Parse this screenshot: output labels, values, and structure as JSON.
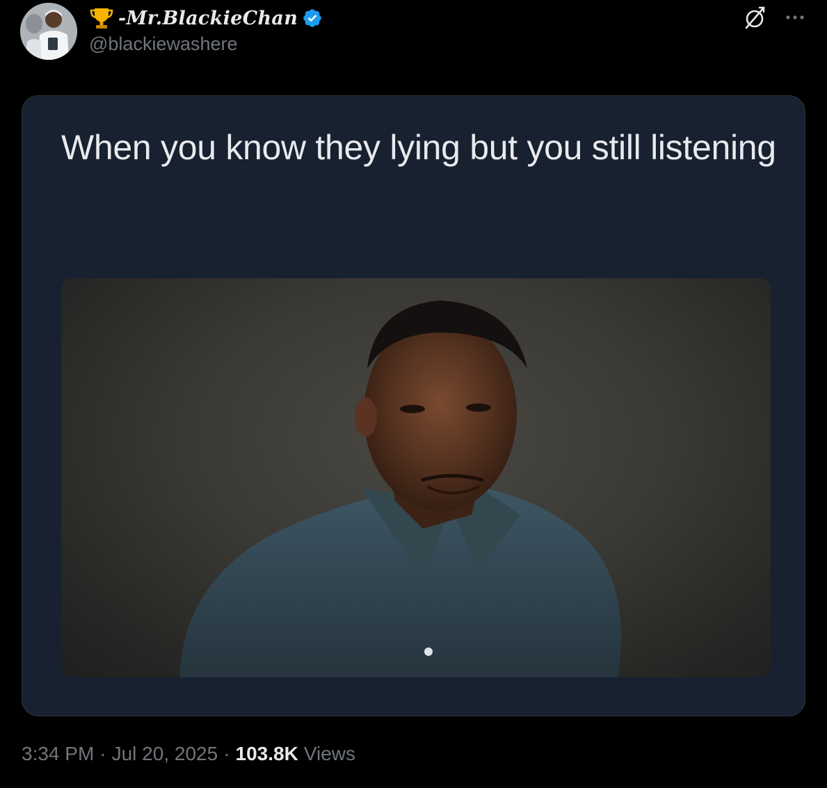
{
  "tweet": {
    "author": {
      "display_name": "-Mr.BlackieChan",
      "handle": "@blackiewashere",
      "verified": true,
      "badge_color": "#1d9bf0"
    },
    "icons": {
      "prefix_emoji": "trophy-icon",
      "grok": "grok-icon",
      "more": "more-options-icon"
    },
    "media": {
      "caption": "When you know they lying but you still listening"
    },
    "meta": {
      "time": "3:34 PM",
      "separator": "·",
      "date": "Jul 20, 2025",
      "views_count": "103.8K",
      "views_label": "Views"
    }
  },
  "colors": {
    "background": "#000000",
    "card_background": "#172130",
    "muted_text": "#71767b",
    "primary_text": "#e7e9ea"
  }
}
